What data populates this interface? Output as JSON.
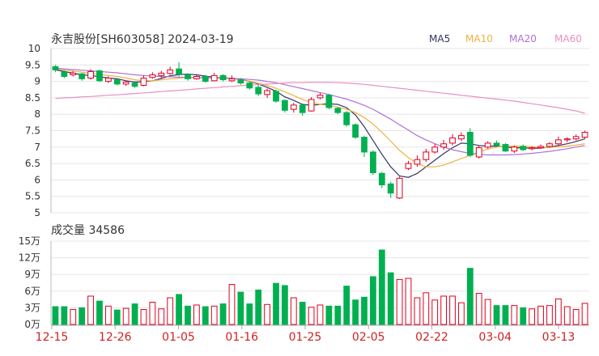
{
  "chart_data": [
    {
      "type": "candlestick",
      "title": "永吉股份[SH603058] 2024-03-19",
      "ylim": [
        5,
        10
      ],
      "yticks": [
        "10",
        "9.5",
        "9",
        "8.5",
        "8",
        "7.5",
        "7",
        "6.5",
        "6",
        "5.5",
        "5"
      ],
      "legend": [
        {
          "name": "MA5",
          "color": "#333366"
        },
        {
          "name": "MA10",
          "color": "#f0b040"
        },
        {
          "name": "MA20",
          "color": "#b070d8"
        },
        {
          "name": "MA60",
          "color": "#e890c0"
        }
      ],
      "up_color": "#e0001f",
      "down_color": "#00b050",
      "candles": [
        [
          9.45,
          9.35,
          9.5,
          9.28
        ],
        [
          9.28,
          9.15,
          9.33,
          9.1
        ],
        [
          9.2,
          9.25,
          9.32,
          9.15
        ],
        [
          9.23,
          9.08,
          9.26,
          9.02
        ],
        [
          9.1,
          9.3,
          9.37,
          9.05
        ],
        [
          9.32,
          9.02,
          9.36,
          8.98
        ],
        [
          9.0,
          9.1,
          9.16,
          8.95
        ],
        [
          9.05,
          8.92,
          9.1,
          8.88
        ],
        [
          8.92,
          8.98,
          9.02,
          8.86
        ],
        [
          8.95,
          8.85,
          9.0,
          8.8
        ],
        [
          8.88,
          9.1,
          9.18,
          8.85
        ],
        [
          9.12,
          9.2,
          9.28,
          9.08
        ],
        [
          9.18,
          9.25,
          9.32,
          9.1
        ],
        [
          9.24,
          9.35,
          9.45,
          9.2
        ],
        [
          9.38,
          9.22,
          9.58,
          9.15
        ],
        [
          9.2,
          9.08,
          9.25,
          9.02
        ],
        [
          9.08,
          9.15,
          9.22,
          9.05
        ],
        [
          9.15,
          9.0,
          9.2,
          8.96
        ],
        [
          9.02,
          9.18,
          9.26,
          9.0
        ],
        [
          9.18,
          9.05,
          9.22,
          9.0
        ],
        [
          9.02,
          9.08,
          9.18,
          8.98
        ],
        [
          9.05,
          8.95,
          9.1,
          8.9
        ],
        [
          8.95,
          8.8,
          9.0,
          8.75
        ],
        [
          8.82,
          8.62,
          8.9,
          8.55
        ],
        [
          8.6,
          8.72,
          8.78,
          8.5
        ],
        [
          8.7,
          8.4,
          8.75,
          8.35
        ],
        [
          8.42,
          8.12,
          8.45,
          8.05
        ],
        [
          8.15,
          8.28,
          8.35,
          8.05
        ],
        [
          8.28,
          8.05,
          8.32,
          7.95
        ],
        [
          8.1,
          8.45,
          8.52,
          8.08
        ],
        [
          8.5,
          8.58,
          8.65,
          8.45
        ],
        [
          8.58,
          8.2,
          8.62,
          8.15
        ],
        [
          8.18,
          8.05,
          8.22,
          8.0
        ],
        [
          8.05,
          7.68,
          8.1,
          7.62
        ],
        [
          7.68,
          7.3,
          7.72,
          7.25
        ],
        [
          7.3,
          6.85,
          7.35,
          6.7
        ],
        [
          6.85,
          6.22,
          6.9,
          6.15
        ],
        [
          6.2,
          5.85,
          6.25,
          5.75
        ],
        [
          5.88,
          5.6,
          5.95,
          5.45
        ],
        [
          5.45,
          6.05,
          6.1,
          5.42
        ],
        [
          6.35,
          6.5,
          6.58,
          6.3
        ],
        [
          6.48,
          6.62,
          6.75,
          6.4
        ],
        [
          6.62,
          6.85,
          6.95,
          6.55
        ],
        [
          6.85,
          7.0,
          7.1,
          6.8
        ],
        [
          7.0,
          7.1,
          7.22,
          6.92
        ],
        [
          7.12,
          7.28,
          7.4,
          7.05
        ],
        [
          7.25,
          7.35,
          7.45,
          7.18
        ],
        [
          7.45,
          6.75,
          7.58,
          6.7
        ],
        [
          6.7,
          6.98,
          7.05,
          6.65
        ],
        [
          7.0,
          7.12,
          7.18,
          6.95
        ],
        [
          7.12,
          7.05,
          7.2,
          7.0
        ],
        [
          7.08,
          6.88,
          7.12,
          6.85
        ],
        [
          6.88,
          7.0,
          7.05,
          6.82
        ],
        [
          7.02,
          6.92,
          7.08,
          6.88
        ],
        [
          6.95,
          6.98,
          7.02,
          6.9
        ],
        [
          6.98,
          7.02,
          7.08,
          6.95
        ],
        [
          7.02,
          7.1,
          7.15,
          6.98
        ],
        [
          7.1,
          7.22,
          7.32,
          7.05
        ],
        [
          7.22,
          7.25,
          7.3,
          7.15
        ],
        [
          7.25,
          7.32,
          7.38,
          7.2
        ],
        [
          7.3,
          7.45,
          7.5,
          7.25
        ]
      ],
      "ma5": [
        9.35,
        9.3,
        9.25,
        9.2,
        9.18,
        9.14,
        9.1,
        9.08,
        9.02,
        8.98,
        8.99,
        9.02,
        9.09,
        9.17,
        9.21,
        9.22,
        9.2,
        9.16,
        9.13,
        9.1,
        9.09,
        9.06,
        9.0,
        8.92,
        8.82,
        8.7,
        8.53,
        8.42,
        8.3,
        8.27,
        8.3,
        8.32,
        8.3,
        8.2,
        7.98,
        7.62,
        7.2,
        6.78,
        6.4,
        6.12,
        6.08,
        6.2,
        6.4,
        6.6,
        6.8,
        6.98,
        7.12,
        7.1,
        7.05,
        7.03,
        7.03,
        7.0,
        6.98,
        6.98,
        6.96,
        6.97,
        7.0,
        7.05,
        7.1,
        7.17,
        7.25
      ],
      "ma10": [
        9.38,
        9.35,
        9.31,
        9.28,
        9.25,
        9.21,
        9.18,
        9.15,
        9.1,
        9.05,
        9.02,
        9.02,
        9.05,
        9.08,
        9.1,
        9.12,
        9.12,
        9.12,
        9.12,
        9.12,
        9.1,
        9.06,
        9.01,
        8.94,
        8.88,
        8.79,
        8.68,
        8.57,
        8.45,
        8.36,
        8.3,
        8.27,
        8.22,
        8.15,
        8.05,
        7.9,
        7.7,
        7.45,
        7.18,
        6.9,
        6.68,
        6.5,
        6.4,
        6.4,
        6.45,
        6.55,
        6.65,
        6.75,
        6.85,
        6.94,
        7.0,
        7.03,
        7.03,
        7.03,
        7.01,
        6.99,
        6.99,
        7.01,
        7.03,
        7.06,
        7.1
      ],
      "ma20": [
        9.4,
        9.38,
        9.36,
        9.34,
        9.32,
        9.3,
        9.28,
        9.26,
        9.23,
        9.2,
        9.18,
        9.16,
        9.15,
        9.14,
        9.13,
        9.12,
        9.11,
        9.11,
        9.1,
        9.1,
        9.09,
        9.08,
        9.06,
        9.04,
        9.0,
        8.96,
        8.9,
        8.84,
        8.78,
        8.72,
        8.66,
        8.6,
        8.53,
        8.46,
        8.37,
        8.27,
        8.15,
        8.0,
        7.85,
        7.68,
        7.52,
        7.35,
        7.22,
        7.1,
        7.0,
        6.92,
        6.86,
        6.81,
        6.78,
        6.76,
        6.76,
        6.76,
        6.77,
        6.79,
        6.81,
        6.84,
        6.87,
        6.91,
        6.95,
        7.0,
        7.05
      ],
      "ma60": [
        8.48,
        8.5,
        8.51,
        8.53,
        8.54,
        8.56,
        8.58,
        8.59,
        8.61,
        8.63,
        8.65,
        8.67,
        8.69,
        8.71,
        8.73,
        8.75,
        8.77,
        8.79,
        8.81,
        8.83,
        8.85,
        8.87,
        8.89,
        8.9,
        8.92,
        8.93,
        8.95,
        8.96,
        8.96,
        8.97,
        8.97,
        8.97,
        8.96,
        8.95,
        8.93,
        8.91,
        8.88,
        8.85,
        8.82,
        8.79,
        8.76,
        8.73,
        8.7,
        8.67,
        8.64,
        8.61,
        8.58,
        8.55,
        8.52,
        8.49,
        8.46,
        8.43,
        8.4,
        8.36,
        8.32,
        8.28,
        8.24,
        8.2,
        8.15,
        8.1,
        8.03
      ]
    },
    {
      "type": "bar",
      "title": "成交量 34586",
      "ylim": [
        0,
        150000
      ],
      "yticks": [
        "15万",
        "12万",
        "9万",
        "6万",
        "3万",
        "0万"
      ],
      "values": [
        32000,
        32000,
        27000,
        30000,
        51000,
        42000,
        33000,
        26000,
        29000,
        37000,
        27000,
        40000,
        28000,
        48000,
        54000,
        33000,
        35000,
        32000,
        33000,
        37000,
        72000,
        58000,
        37000,
        62000,
        36000,
        74000,
        70000,
        48000,
        40000,
        31000,
        35000,
        33000,
        33000,
        69000,
        44000,
        49000,
        86000,
        134000,
        93000,
        81000,
        83000,
        48000,
        57000,
        44000,
        51000,
        51000,
        39000,
        101000,
        56000,
        45000,
        34000,
        34000,
        34000,
        30000,
        28000,
        33000,
        34000,
        46000,
        32000,
        27000,
        38000
      ]
    }
  ],
  "x_dates": [
    "12-15",
    "12-26",
    "01-05",
    "01-16",
    "01-25",
    "02-05",
    "02-22",
    "03-04",
    "03-13"
  ]
}
